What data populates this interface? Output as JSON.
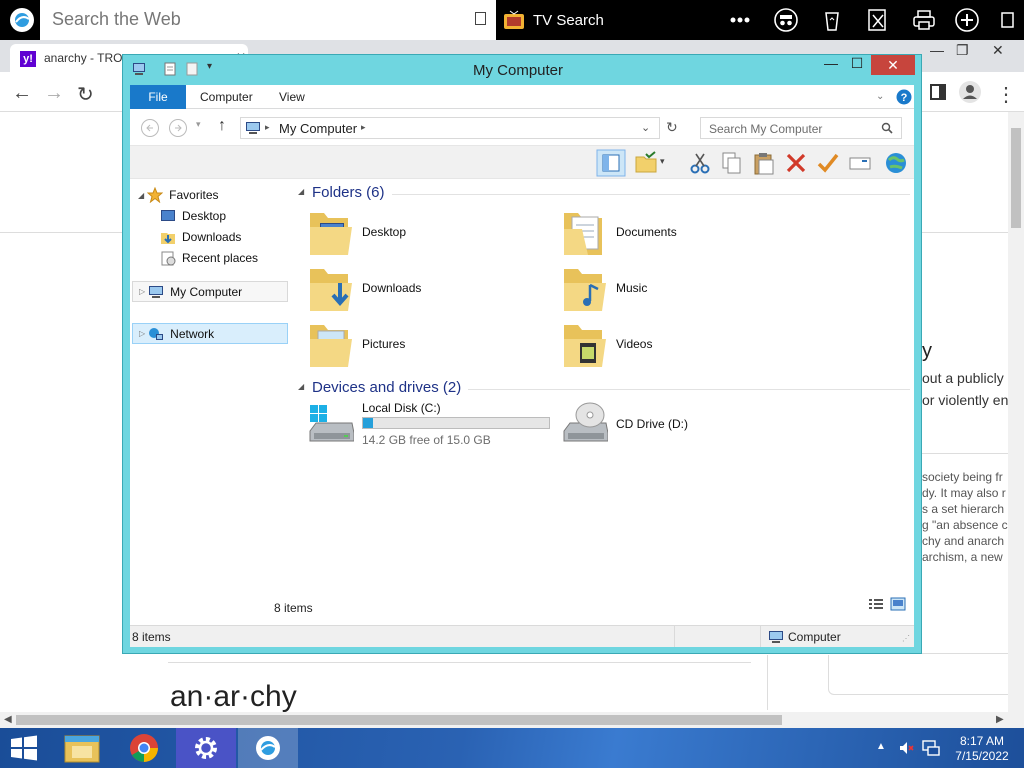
{
  "search_toolbar": {
    "search_placeholder": "Search the Web",
    "tv_search_label": "TV Search"
  },
  "browser": {
    "tab_title": "anarchy - TRO",
    "favicon_letter": "y!",
    "page_heading": "an·ar·chy",
    "right_snippets": {
      "heading_fragment": "y",
      "line1": "out a publicly c",
      "line2": "or violently en",
      "body_lines": [
        "society being fr",
        "dy. It may also r",
        "s a set hierarch",
        "g \"an absence c",
        "chy and anarch",
        "archism, a new"
      ]
    }
  },
  "explorer": {
    "window_title": "My Computer",
    "ribbon_tabs": [
      "File",
      "Computer",
      "View"
    ],
    "address": "My Computer",
    "search_placeholder": "Search My Computer",
    "nav": {
      "favorites": "Favorites",
      "favorites_items": [
        "Desktop",
        "Downloads",
        "Recent places"
      ],
      "my_computer": "My Computer",
      "network": "Network"
    },
    "folders_header": "Folders (6)",
    "folders": [
      {
        "name": "Desktop",
        "icon": "desktop-folder-icon"
      },
      {
        "name": "Documents",
        "icon": "documents-folder-icon"
      },
      {
        "name": "Downloads",
        "icon": "downloads-folder-icon"
      },
      {
        "name": "Music",
        "icon": "music-folder-icon"
      },
      {
        "name": "Pictures",
        "icon": "pictures-folder-icon"
      },
      {
        "name": "Videos",
        "icon": "videos-folder-icon"
      }
    ],
    "drives_header": "Devices and drives (2)",
    "drives": [
      {
        "name": "Local Disk (C:)",
        "free_text": "14.2 GB free of 15.0 GB",
        "used_fraction": 0.053
      },
      {
        "name": "CD Drive (D:)"
      }
    ],
    "item_count_inner": "8 items",
    "status_items": "8 items",
    "status_location": "Computer"
  },
  "taskbar": {
    "time": "8:17 AM",
    "date": "7/15/2022"
  },
  "colors": {
    "window_frame": "#6fd6e0",
    "file_tab": "#1979ca",
    "close_button": "#c7453d",
    "taskbar": "#1b4f9e",
    "group_header": "#1e3287"
  }
}
